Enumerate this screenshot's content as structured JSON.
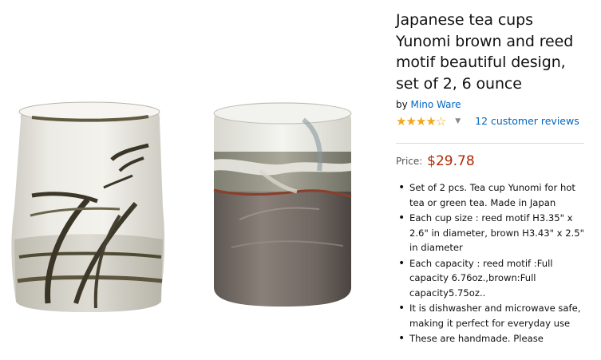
{
  "product": {
    "title_lines": [
      "Japanese tea cups",
      "Yunomi brown and reed",
      "motif beautiful design,",
      "set of 2, 6 ounce"
    ],
    "by_prefix": "by",
    "brand": "Mino Ware",
    "rating_stars": 4,
    "rating_max": 5,
    "reviews_label": "12 customer reviews",
    "price_label": "Price:",
    "price": "$29.78",
    "bullets": [
      "Set of 2 pcs. Tea cup Yunomi for hot tea or green tea. Made in Japan",
      "Each cup size : reed motif H3.35\" x 2.6\" in diameter, brown H3.43\" x 2.5\" in diameter",
      "Each capacity : reed motif :Full capacity 6.76oz.,brown:Full capacity5.75oz..",
      "It is dishwasher and microwave safe, making it perfect for everyday use",
      "These are handmade. Please"
    ],
    "icons": {
      "star": "star-icon",
      "chevron": "chevron-down-icon"
    },
    "colors": {
      "link": "#0066c0",
      "price": "#b12704",
      "star": "#f0a818"
    }
  }
}
